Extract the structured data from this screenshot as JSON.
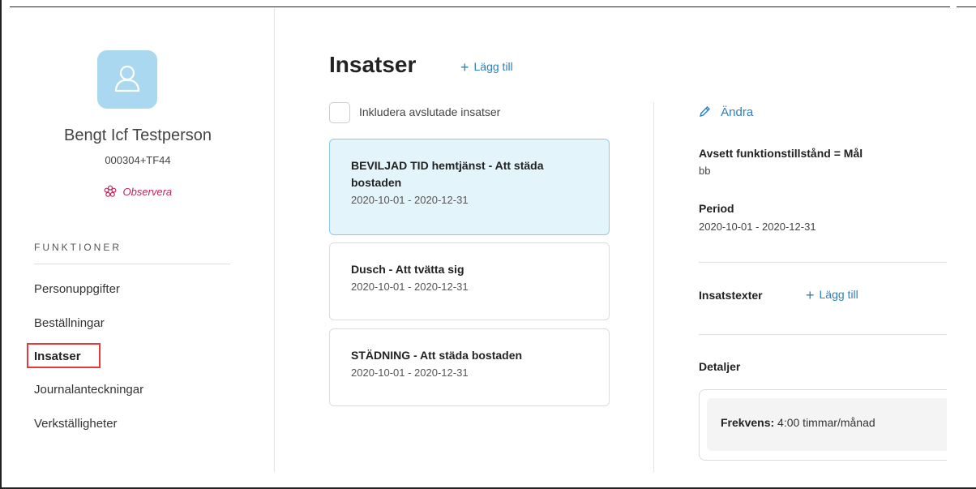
{
  "person": {
    "name": "Bengt Icf Testperson",
    "id": "000304+TF44",
    "observe_label": "Observera",
    "avatar_icon": "user-icon"
  },
  "sidebar": {
    "heading": "FUNKTIONER",
    "items": [
      {
        "label": "Personuppgifter",
        "active": false
      },
      {
        "label": "Beställningar",
        "active": false
      },
      {
        "label": "Insatser",
        "active": true
      },
      {
        "label": "Journalanteckningar",
        "active": false
      },
      {
        "label": "Verkställigheter",
        "active": false
      }
    ]
  },
  "main": {
    "title": "Insatser",
    "add_label": "Lägg till",
    "include_finished_label": "Inkludera avslutade insatser",
    "cards": [
      {
        "title": "BEVILJAD TID hemtjänst - Att städa bostaden",
        "period": "2020-10-01 - 2020-12-31",
        "selected": true
      },
      {
        "title": "Dusch - Att tvätta sig",
        "period": "2020-10-01 - 2020-12-31",
        "selected": false
      },
      {
        "title": "STÄDNING - Att städa bostaden",
        "period": "2020-10-01 - 2020-12-31",
        "selected": false
      }
    ]
  },
  "detail": {
    "edit_label": "Ändra",
    "goal_label": "Avsett funktionstillstånd = Mål",
    "goal_value": "bb",
    "period_label": "Period",
    "period_value": "2020-10-01 - 2020-12-31",
    "texts_label": "Insatstexter",
    "texts_add_label": "Lägg till",
    "details_label": "Detaljer",
    "frequency_label": "Frekvens:",
    "frequency_value": "4:00 timmar/månad"
  },
  "colors": {
    "accent": "#2d7fc1",
    "selected_card_bg": "#e3f4fb",
    "avatar_bg": "#a9d8f0",
    "observe": "#c0265a",
    "highlight": "#e33b3b"
  }
}
